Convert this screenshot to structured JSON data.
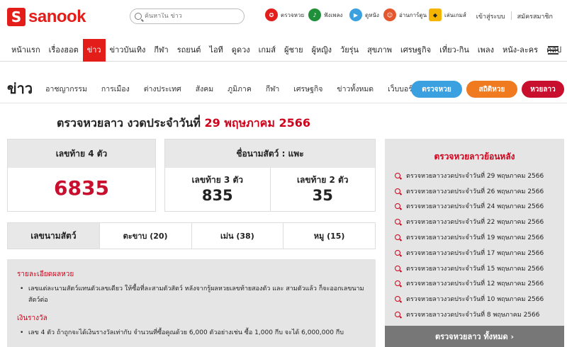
{
  "header": {
    "logo_letter": "S",
    "logo_text": "sanook",
    "search_placeholder": "ค้นหาใน ข่าว",
    "quick_links": [
      {
        "label": "ตรวจหวย",
        "icon": "lottery-icon",
        "color": "#e31d1a"
      },
      {
        "label": "ฟังเพลง",
        "icon": "music-icon",
        "color": "#1f8f3a"
      },
      {
        "label": "ดูหนัง",
        "icon": "play-icon",
        "color": "#3aa0e0"
      },
      {
        "label": "อ่านการ์ตูน",
        "icon": "cartoon-icon",
        "color": "#e4572e"
      },
      {
        "label": "เล่นเกมส์",
        "icon": "game-icon",
        "color": "#f5b400"
      }
    ],
    "login": "เข้าสู่ระบบ",
    "register": "สมัครสมาชิก"
  },
  "main_nav": [
    "หน้าแรก",
    "เรื่องฮอต",
    "ข่าว",
    "ข่าวบันเทิง",
    "กีฬา",
    "รถยนต์",
    "ไอที",
    "ดูดวง",
    "เกมส์",
    "ผู้ชาย",
    "ผู้หญิง",
    "วัยรุ่น",
    "สุขภาพ",
    "เศรษฐกิจ",
    "เที่ยว-กิน",
    "เพลง",
    "หนัง-ละคร",
    "คลิป"
  ],
  "main_nav_active": "ข่าว",
  "sub_nav": {
    "title": "ข่าว",
    "items": [
      "อาชญากรรม",
      "การเมือง",
      "ต่างประเทศ",
      "สังคม",
      "ภูมิภาค",
      "กีฬา",
      "เศรษฐกิจ",
      "ข่าวทั้งหมด",
      "เว็บบอร์ด"
    ],
    "pills": [
      {
        "label": "ตรวจหวย",
        "color": "#3aa0e0"
      },
      {
        "label": "สถิติหวย",
        "color": "#f07a1f"
      },
      {
        "label": "หวยลาว",
        "color": "#c8102e"
      }
    ]
  },
  "headline": {
    "prefix": "ตรวจหวยลาว งวดประจำวันที่",
    "date": "29 พฤษภาคม 2566"
  },
  "result": {
    "four_label": "เลขท้าย 4 ตัว",
    "four_value": "6835",
    "animal_name_label": "ชื่อนามสัตว์ : แพะ",
    "three_label": "เลขท้าย 3 ตัว",
    "three_value": "835",
    "two_label": "เลขท้าย 2 ตัว",
    "two_value": "35"
  },
  "animals": {
    "label": "เลขนามสัตว์",
    "items": [
      "ตะขาบ (20)",
      "เม่น (38)",
      "หมู (15)"
    ]
  },
  "details": {
    "heading1": "รายละเอียดผลหวย",
    "text1": "เลขแต่ละนามสัตว์แทนตัวเลขเดียว ให้ซื้อที่ละสามตัวสัตว์ หลังจากรู้ผลหวยเลขท้ายสองตัว และ สามตัวแล้ว ก็จะออกเลขนาม สัตว์ต่อ",
    "heading2": "เงินรางวัล",
    "text2": "เลข 4 ตัว ถ้าถูกจะได้เงินรางวัลเท่ากับ จำนวนที่ซื้อคูณด้วย 6,000 ตัวอย่างเช่น ซื้อ 1,000 กีบ จะได้ 6,000,000 กีบ"
  },
  "sidebar": {
    "heading": "ตรวจหวยลาวย้อนหลัง",
    "items": [
      "ตรวจหวยลาวงวดประจำวันที่ 29 พฤษภาคม 2566",
      "ตรวจหวยลาวงวดประจำวันที่ 26 พฤษภาคม 2566",
      "ตรวจหวยลาวงวดประจำวันที่ 24 พฤษภาคม 2566",
      "ตรวจหวยลาวงวดประจำวันที่ 22 พฤษภาคม 2566",
      "ตรวจหวยลาวงวดประจำวันที่ 19 พฤษภาคม 2566",
      "ตรวจหวยลาวงวดประจำวันที่ 17 พฤษภาคม 2566",
      "ตรวจหวยลาวงวดประจำวันที่ 15 พฤษภาคม 2566",
      "ตรวจหวยลาวงวดประจำวันที่ 12 พฤษภาคม 2566",
      "ตรวจหวยลาวงวดประจำวันที่ 10 พฤษภาคม 2566",
      "ตรวจหวยลาวงวดประจำวันที่ 8 พฤษภาคม 2566"
    ],
    "all_button": "ตรวจหวยลาว ทั้งหมด ›"
  }
}
